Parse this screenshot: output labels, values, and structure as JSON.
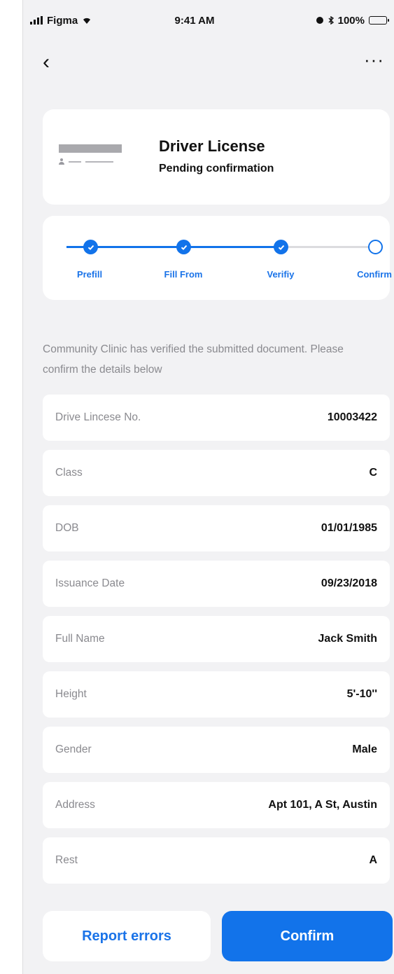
{
  "status_bar": {
    "carrier": "Figma",
    "time": "9:41 AM",
    "battery": "100%"
  },
  "nav": {
    "back_label": "‹",
    "more_label": "···"
  },
  "document": {
    "title": "Driver License",
    "status": "Pending confirmation"
  },
  "stepper": {
    "steps": [
      {
        "label": "Prefill",
        "state": "done"
      },
      {
        "label": "Fill From",
        "state": "done"
      },
      {
        "label": "Verifiy",
        "state": "done"
      },
      {
        "label": "Confirm",
        "state": "current"
      }
    ]
  },
  "intro": "Community Clinic has verified the submitted document. Please confirm the details below",
  "fields": [
    {
      "label": "Drive Lincese No.",
      "value": "10003422"
    },
    {
      "label": "Class",
      "value": "C"
    },
    {
      "label": "DOB",
      "value": "01/01/1985"
    },
    {
      "label": "Issuance Date",
      "value": "09/23/2018"
    },
    {
      "label": "Full Name",
      "value": "Jack Smith"
    },
    {
      "label": "Height",
      "value": "5'-10''"
    },
    {
      "label": "Gender",
      "value": "Male"
    },
    {
      "label": "Address",
      "value": "Apt 101, A St, Austin"
    },
    {
      "label": "Rest",
      "value": "A"
    }
  ],
  "actions": {
    "report_label": "Report errors",
    "confirm_label": "Confirm"
  },
  "colors": {
    "accent": "#1273ea",
    "background": "#f2f2f4",
    "muted_text": "#8a8a8f"
  }
}
